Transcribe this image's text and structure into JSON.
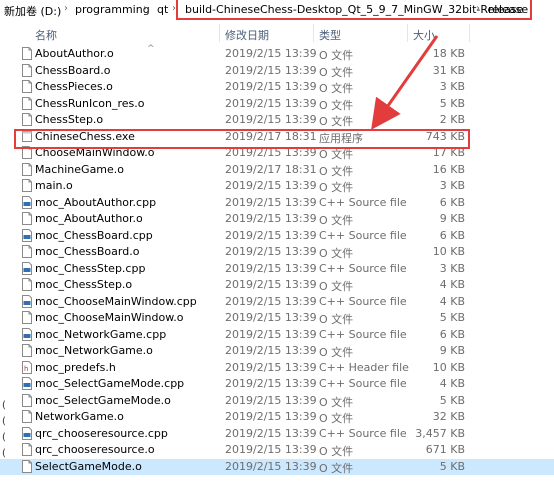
{
  "breadcrumb": {
    "items": [
      "新加卷 (D:)",
      "programming",
      "qt",
      "build-ChineseChess-Desktop_Qt_5_9_7_MinGW_32bit-Release",
      "release"
    ]
  },
  "columns": {
    "name": "名称",
    "date": "修改日期",
    "type": "类型",
    "size": "大小"
  },
  "files": [
    {
      "name": "AboutAuthor.o",
      "date": "2019/2/15 13:39",
      "type": "O 文件",
      "size": "18 KB",
      "icon": "file-icon"
    },
    {
      "name": "ChessBoard.o",
      "date": "2019/2/15 13:39",
      "type": "O 文件",
      "size": "31 KB",
      "icon": "file-icon"
    },
    {
      "name": "ChessPieces.o",
      "date": "2019/2/15 13:39",
      "type": "O 文件",
      "size": "3 KB",
      "icon": "file-icon"
    },
    {
      "name": "ChessRunIcon_res.o",
      "date": "2019/2/15 13:39",
      "type": "O 文件",
      "size": "5 KB",
      "icon": "file-icon"
    },
    {
      "name": "ChessStep.o",
      "date": "2019/2/15 13:39",
      "type": "O 文件",
      "size": "2 KB",
      "icon": "file-icon"
    },
    {
      "name": "ChineseChess.exe",
      "date": "2019/2/17 18:31",
      "type": "应用程序",
      "size": "743 KB",
      "icon": "exe-icon"
    },
    {
      "name": "ChooseMainWindow.o",
      "date": "2019/2/15 13:39",
      "type": "O 文件",
      "size": "17 KB",
      "icon": "file-icon"
    },
    {
      "name": "MachineGame.o",
      "date": "2019/2/17 18:31",
      "type": "O 文件",
      "size": "16 KB",
      "icon": "file-icon"
    },
    {
      "name": "main.o",
      "date": "2019/2/15 13:39",
      "type": "O 文件",
      "size": "3 KB",
      "icon": "file-icon"
    },
    {
      "name": "moc_AboutAuthor.cpp",
      "date": "2019/2/15 13:39",
      "type": "C++ Source file",
      "size": "6 KB",
      "icon": "cpp-icon"
    },
    {
      "name": "moc_AboutAuthor.o",
      "date": "2019/2/15 13:39",
      "type": "O 文件",
      "size": "9 KB",
      "icon": "file-icon"
    },
    {
      "name": "moc_ChessBoard.cpp",
      "date": "2019/2/15 13:39",
      "type": "C++ Source file",
      "size": "6 KB",
      "icon": "cpp-icon"
    },
    {
      "name": "moc_ChessBoard.o",
      "date": "2019/2/15 13:39",
      "type": "O 文件",
      "size": "10 KB",
      "icon": "file-icon"
    },
    {
      "name": "moc_ChessStep.cpp",
      "date": "2019/2/15 13:39",
      "type": "C++ Source file",
      "size": "3 KB",
      "icon": "cpp-icon"
    },
    {
      "name": "moc_ChessStep.o",
      "date": "2019/2/15 13:39",
      "type": "O 文件",
      "size": "4 KB",
      "icon": "file-icon"
    },
    {
      "name": "moc_ChooseMainWindow.cpp",
      "date": "2019/2/15 13:39",
      "type": "C++ Source file",
      "size": "4 KB",
      "icon": "cpp-icon"
    },
    {
      "name": "moc_ChooseMainWindow.o",
      "date": "2019/2/15 13:39",
      "type": "O 文件",
      "size": "5 KB",
      "icon": "file-icon"
    },
    {
      "name": "moc_NetworkGame.cpp",
      "date": "2019/2/15 13:39",
      "type": "C++ Source file",
      "size": "6 KB",
      "icon": "cpp-icon"
    },
    {
      "name": "moc_NetworkGame.o",
      "date": "2019/2/15 13:39",
      "type": "O 文件",
      "size": "9 KB",
      "icon": "file-icon"
    },
    {
      "name": "moc_predefs.h",
      "date": "2019/2/15 13:39",
      "type": "C++ Header file",
      "size": "10 KB",
      "icon": "h-icon"
    },
    {
      "name": "moc_SelectGameMode.cpp",
      "date": "2019/2/15 13:39",
      "type": "C++ Source file",
      "size": "4 KB",
      "icon": "cpp-icon"
    },
    {
      "name": "moc_SelectGameMode.o",
      "date": "2019/2/15 13:39",
      "type": "O 文件",
      "size": "5 KB",
      "icon": "file-icon"
    },
    {
      "name": "NetworkGame.o",
      "date": "2019/2/15 13:39",
      "type": "O 文件",
      "size": "32 KB",
      "icon": "file-icon"
    },
    {
      "name": "qrc_chooseresource.cpp",
      "date": "2019/2/15 13:39",
      "type": "C++ Source file",
      "size": "3,457 KB",
      "icon": "cpp-icon"
    },
    {
      "name": "qrc_chooseresource.o",
      "date": "2019/2/15 13:39",
      "type": "O 文件",
      "size": "671 KB",
      "icon": "file-icon"
    },
    {
      "name": "SelectGameMode.o",
      "date": "2019/2/15 13:39",
      "type": "O 文件",
      "size": "5 KB",
      "icon": "file-icon"
    }
  ],
  "left_rail": [
    "(",
    "(",
    "(",
    "("
  ],
  "colors": {
    "highlight": "#e23c3c",
    "selected": "#cce8ff"
  }
}
